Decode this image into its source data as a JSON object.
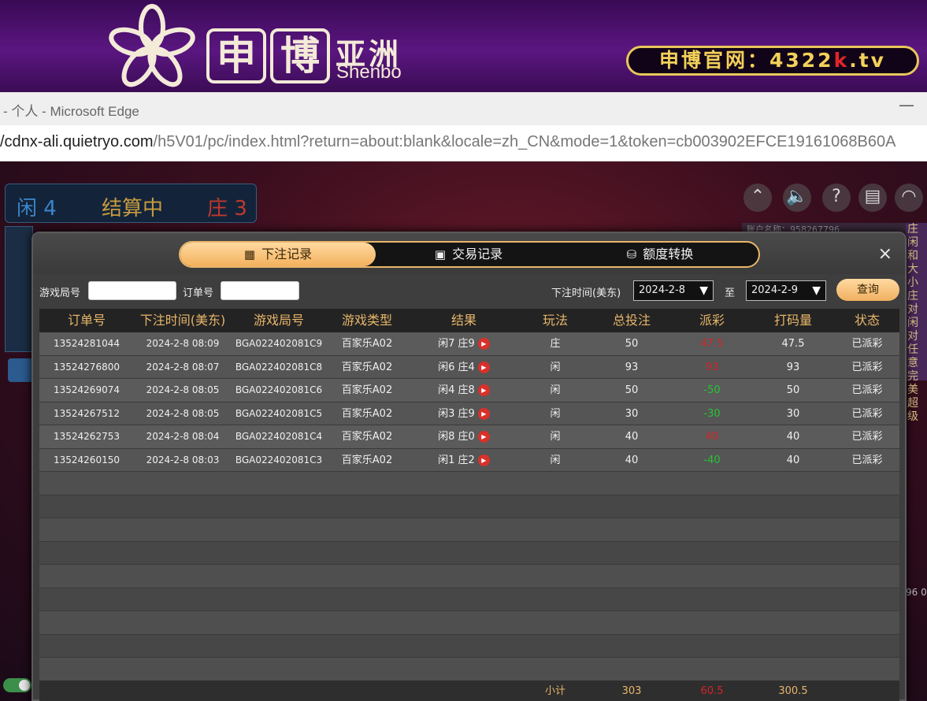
{
  "banner": {
    "logo_chars": [
      "申",
      "博"
    ],
    "logo_asia": "亚洲",
    "logo_en": "Shenbo",
    "site_label": "申博官网：4322",
    "site_red": "k",
    "site_tail": ".tv"
  },
  "browser": {
    "title": "- 个人 - Microsoft Edge",
    "minimize": "—",
    "url_host": "/cdnx-ali.quietryo.com",
    "url_path": "/h5V01/pc/index.html?return=about:blank&locale=zh_CN&mode=1&token=cb003902EFCE19161068B60A"
  },
  "game": {
    "player": "闲 4",
    "settling": "结算中",
    "banker": "庄 3",
    "account": "账户名称：958267796",
    "side_labels": "庄闲和大小庄对闲对任意完美超级",
    "side_nums": "96\n0",
    "icons": [
      "chevron-up-icon",
      "speaker-icon",
      "help-icon",
      "document-icon",
      "wifi-icon"
    ]
  },
  "modal": {
    "tabs": [
      {
        "label": "下注记录",
        "icon": "calendar-icon"
      },
      {
        "label": "交易记录",
        "icon": "clipboard-icon"
      },
      {
        "label": "额度转换",
        "icon": "coins-icon"
      }
    ],
    "close": "×",
    "filters": {
      "game_no_label": "游戏局号",
      "order_no_label": "订单号",
      "time_label": "下注时间(美东)",
      "from": "2024-2-8",
      "to_sep": "至",
      "to": "2024-2-9",
      "query": "查询"
    },
    "columns": [
      "订单号",
      "下注时间(美东)",
      "游戏局号",
      "游戏类型",
      "结果",
      "玩法",
      "总投注",
      "派彩",
      "打码量",
      "状态"
    ],
    "rows": [
      {
        "order": "13524281044",
        "time": "2024-2-8 08:09",
        "game_no": "BGA022402081C9",
        "type": "百家乐A02",
        "result": "闲7 庄9",
        "play": "庄",
        "bet": "50",
        "payout": "47.5",
        "payout_color": "neg",
        "turnover": "47.5",
        "status": "已派彩"
      },
      {
        "order": "13524276800",
        "time": "2024-2-8 08:07",
        "game_no": "BGA022402081C8",
        "type": "百家乐A02",
        "result": "闲6 庄4",
        "play": "闲",
        "bet": "93",
        "payout": "93",
        "payout_color": "neg",
        "turnover": "93",
        "status": "已派彩"
      },
      {
        "order": "13524269074",
        "time": "2024-2-8 08:05",
        "game_no": "BGA022402081C6",
        "type": "百家乐A02",
        "result": "闲4 庄8",
        "play": "闲",
        "bet": "50",
        "payout": "-50",
        "payout_color": "pos",
        "turnover": "50",
        "status": "已派彩"
      },
      {
        "order": "13524267512",
        "time": "2024-2-8 08:05",
        "game_no": "BGA022402081C5",
        "type": "百家乐A02",
        "result": "闲3 庄9",
        "play": "闲",
        "bet": "30",
        "payout": "-30",
        "payout_color": "pos",
        "turnover": "30",
        "status": "已派彩"
      },
      {
        "order": "13524262753",
        "time": "2024-2-8 08:04",
        "game_no": "BGA022402081C4",
        "type": "百家乐A02",
        "result": "闲8 庄0",
        "play": "闲",
        "bet": "40",
        "payout": "40",
        "payout_color": "neg",
        "turnover": "40",
        "status": "已派彩"
      },
      {
        "order": "13524260150",
        "time": "2024-2-8 08:03",
        "game_no": "BGA022402081C3",
        "type": "百家乐A02",
        "result": "闲1 庄2",
        "play": "闲",
        "bet": "40",
        "payout": "-40",
        "payout_color": "pos",
        "turnover": "40",
        "status": "已派彩"
      }
    ],
    "footer": {
      "label": "小计",
      "bet": "303",
      "payout": "60.5",
      "turnover": "300.5"
    }
  },
  "colors": {
    "accent": "#e8b66a",
    "negative": "#d0252a",
    "positive": "#27c335"
  }
}
